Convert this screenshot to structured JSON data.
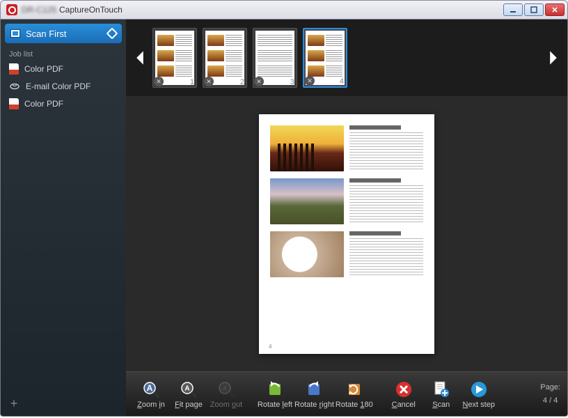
{
  "window": {
    "title": "CaptureOnTouch"
  },
  "sidebar": {
    "scan_first_label": "Scan First",
    "joblist_header": "Job list",
    "items": [
      {
        "label": "Color PDF",
        "icon": "pdf"
      },
      {
        "label": "E-mail Color PDF",
        "icon": "mail"
      },
      {
        "label": "Color PDF",
        "icon": "pdf"
      }
    ]
  },
  "thumbs": {
    "pages": [
      {
        "num": "1",
        "selected": false
      },
      {
        "num": "2",
        "selected": false
      },
      {
        "num": "3",
        "selected": false
      },
      {
        "num": "4",
        "selected": true
      }
    ]
  },
  "preview": {
    "page_num": "4"
  },
  "toolbar": {
    "zoom_in": "Zoom in",
    "fit_page": "Fit page",
    "zoom_out": "Zoom out",
    "rotate_left": "Rotate left",
    "rotate_right": "Rotate right",
    "rotate_180": "Rotate 180",
    "cancel": "Cancel",
    "scan": "Scan",
    "next_step": "Next step",
    "page_label": "Page:",
    "page_value": "4 / 4"
  }
}
